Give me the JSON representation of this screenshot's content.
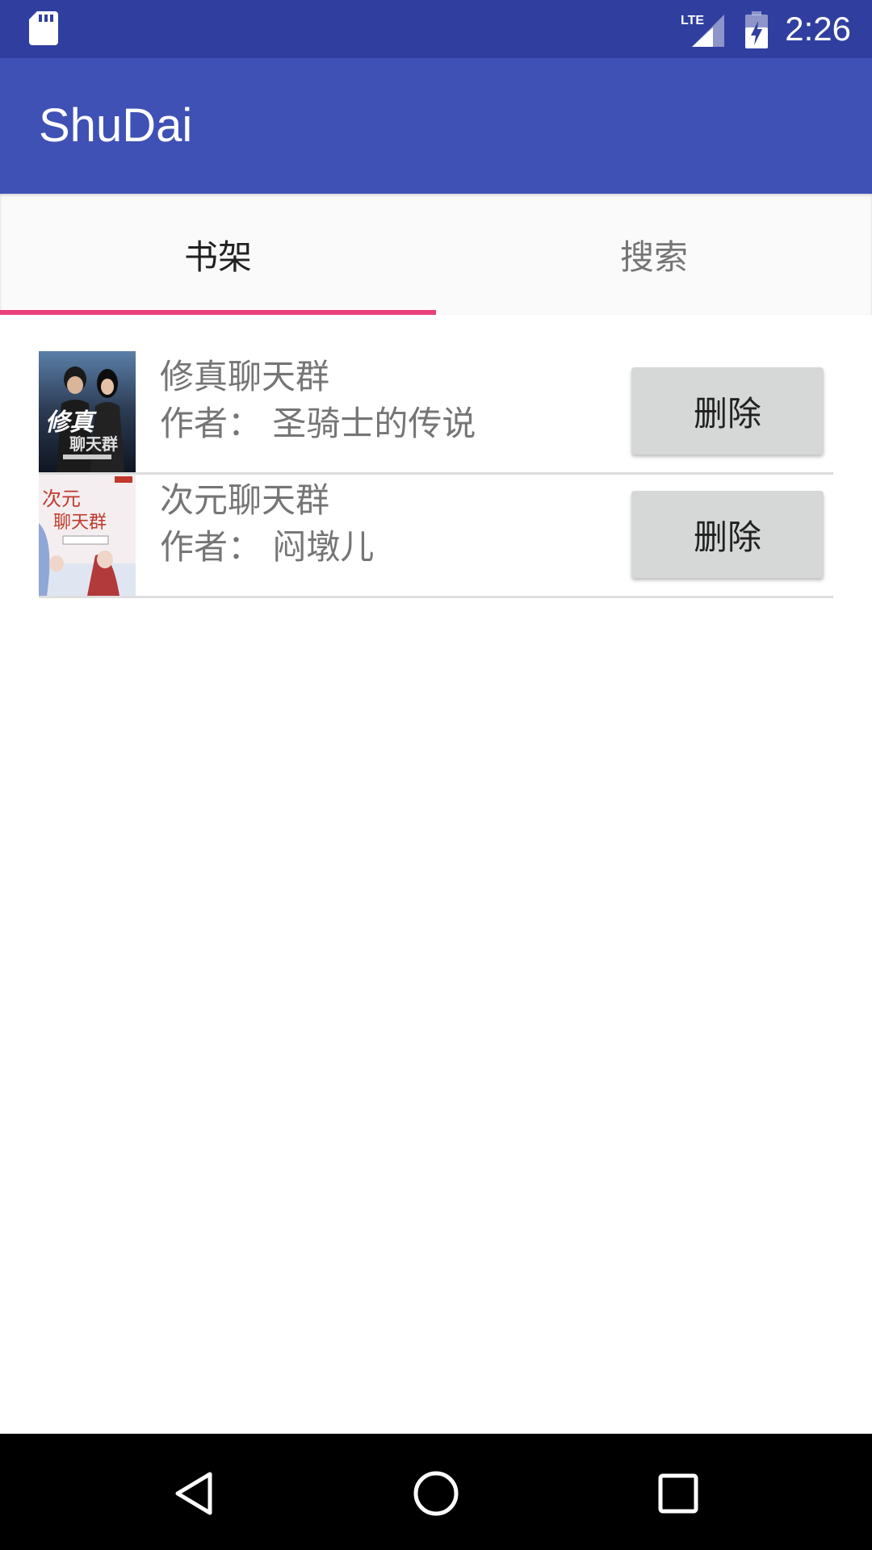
{
  "status_bar": {
    "network": "LTE",
    "time": "2:26"
  },
  "app_bar": {
    "title": "ShuDai"
  },
  "tabs": [
    {
      "label": "书架",
      "selected": true
    },
    {
      "label": "搜索",
      "selected": false
    }
  ],
  "books": [
    {
      "title": "修真聊天群",
      "author_label": "作者：",
      "author": "圣骑士的传说",
      "delete_label": "删除",
      "cover_text": "修真聊天群"
    },
    {
      "title": "次元聊天群",
      "author_label": "作者：",
      "author": "闷墩儿",
      "delete_label": "删除",
      "cover_text": "次元聊天群"
    }
  ],
  "colors": {
    "status_bar": "#303F9F",
    "primary": "#3F51B5",
    "accent": "#EC407A"
  },
  "icons": {
    "sd": "sd-card-icon",
    "signal": "lte-signal-icon",
    "battery": "battery-charging-icon",
    "back": "back-icon",
    "home": "home-icon",
    "recents": "recents-icon"
  }
}
